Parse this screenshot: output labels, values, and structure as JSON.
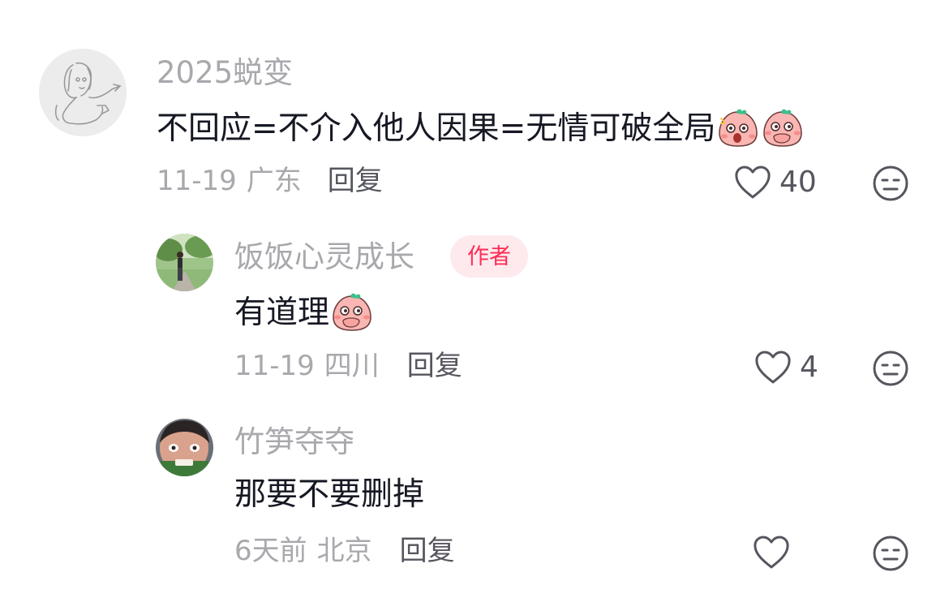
{
  "comments": [
    {
      "username": "2025蜕变",
      "content": "不回应=不介入他人因果=无情可破全局",
      "emojis": [
        "shocked-peach-emoji",
        "covering-mouth-peach-emoji"
      ],
      "date": "11-19",
      "location": "广东",
      "reply_label": "回复",
      "like_count": "40",
      "avatar": "sketch-avatar"
    },
    {
      "username": "饭饭心灵成长",
      "badge": "作者",
      "content": "有道理",
      "emojis": [
        "covering-mouth-peach-emoji"
      ],
      "date": "11-19",
      "location": "四川",
      "reply_label": "回复",
      "like_count": "4",
      "avatar": "outdoor-photo-avatar"
    },
    {
      "username": "竹笋夺夺",
      "content": "那要不要删掉",
      "emojis": [],
      "date": "6天前",
      "location": "北京",
      "reply_label": "回复",
      "like_count": "",
      "avatar": "face-photo-avatar"
    }
  ],
  "colors": {
    "username": "#a8a8ad",
    "badge_bg": "#feeaec",
    "badge_text": "#fe2c55",
    "meta": "#a8a8ad",
    "reply": "#55565e",
    "icon": "#55565e"
  },
  "icons": {
    "like": "heart-outline-icon",
    "dislike": "meh-face-icon"
  }
}
